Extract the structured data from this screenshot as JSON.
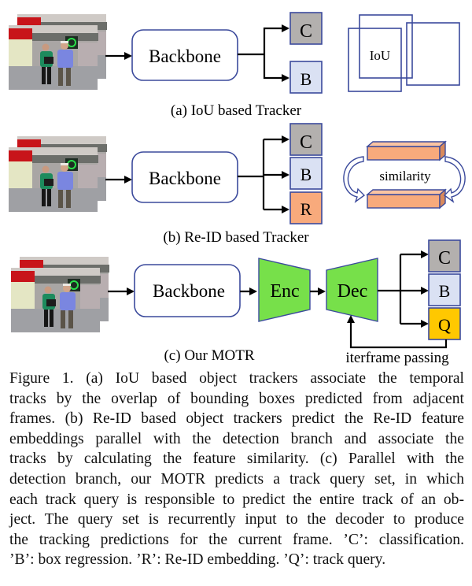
{
  "figure": {
    "panel_a": {
      "backbone_label": "Backbone",
      "outputs": [
        {
          "label": "C",
          "meaning": "classification",
          "fill": "#b3b0ae"
        },
        {
          "label": "B",
          "meaning": "box regression",
          "fill": "#dae1f3"
        }
      ],
      "iou_label": "IoU",
      "subcaption": "(a) IoU based Tracker"
    },
    "panel_b": {
      "backbone_label": "Backbone",
      "outputs": [
        {
          "label": "C",
          "meaning": "classification",
          "fill": "#b3b0ae"
        },
        {
          "label": "B",
          "meaning": "box regression",
          "fill": "#dae1f3"
        },
        {
          "label": "R",
          "meaning": "Re-ID embedding",
          "fill": "#f8aa7c"
        }
      ],
      "similarity_label": "similarity",
      "subcaption": "(b) Re-ID based Tracker"
    },
    "panel_c": {
      "backbone_label": "Backbone",
      "encoder_label": "Enc",
      "decoder_label": "Dec",
      "outputs": [
        {
          "label": "C",
          "meaning": "classification",
          "fill": "#b3b0ae"
        },
        {
          "label": "B",
          "meaning": "box regression",
          "fill": "#dae1f3"
        },
        {
          "label": "Q",
          "meaning": "track query",
          "fill": "#ffc800"
        }
      ],
      "feedback_label": "iterframe passing",
      "subcaption": "(c) Our MOTR"
    },
    "colors": {
      "box_stroke": "#3b4a9c",
      "enc_dec_fill": "#77e04a",
      "embedding_fill": "#f8aa7c"
    }
  },
  "caption": {
    "lines": [
      "Figure 1. (a) IoU based object trackers associate the temporal",
      "tracks by the overlap of bounding boxes predicted from adjacent",
      "frames. (b) Re-ID based object trackers predict the Re-ID feature",
      "embeddings parallel with the detection branch and associate the",
      "tracks by calculating the feature similarity.  (c) Parallel with the",
      "detection branch, our MOTR predicts a track query set, in which",
      "each track query is responsible to predict the entire track of an ob-",
      "ject.  The query set is recurrently input to the decoder to produce",
      "the tracking predictions for the current frame. ’C’: classification.",
      "’B’: box regression. ’R’: Re-ID embedding. ’Q’: track query."
    ]
  }
}
